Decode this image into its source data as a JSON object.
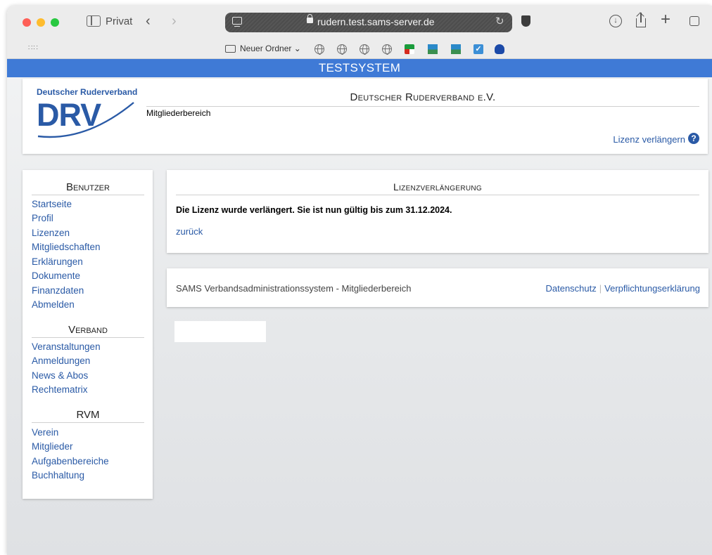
{
  "browser": {
    "private_label": "Privat",
    "url": "rudern.test.sams-server.de",
    "favorites": {
      "folder_label": "Neuer Ordner ⌄",
      "items": [
        "globe-icon",
        "globe-icon",
        "globe-icon",
        "globe-icon",
        "nrw-favicon",
        "sea-favicon",
        "sea-favicon",
        "check-favicon",
        "alien-favicon"
      ]
    }
  },
  "banner": {
    "text": "TESTSYSTEM"
  },
  "header": {
    "logo_text": "Deutscher Ruderverband",
    "logo_mark": "DRV",
    "org_title": "Deutscher Ruderverband e.V.",
    "subtitle": "Mitgliederbereich",
    "renew_link": "Lizenz verlängern"
  },
  "nav": {
    "sections": [
      {
        "title": "Benutzer",
        "items": [
          "Startseite",
          "Profil",
          "Lizenzen",
          "Mitgliedschaften",
          "Erklärungen",
          "Dokumente",
          "Finanzdaten",
          "Abmelden"
        ]
      },
      {
        "title": "Verband",
        "items": [
          "Veranstaltungen",
          "Anmeldungen",
          "News & Abos",
          "Rechtematrix"
        ]
      },
      {
        "title": "RVM",
        "items": [
          "Verein",
          "Mitglieder",
          "Aufgabenbereiche",
          "Buchhaltung"
        ]
      }
    ]
  },
  "main": {
    "title": "Lizenzverlängerung",
    "message": "Die Lizenz wurde verlängert. Sie ist nun gültig bis zum 31.12.2024.",
    "back_link": "zurück"
  },
  "footer": {
    "left_text": "SAMS Verbandsadministrationssystem - Mitgliederbereich",
    "link_privacy": "Datenschutz",
    "link_commitment": "Verpflichtungserklärung"
  },
  "colors": {
    "accent": "#3f7ad6",
    "link": "#2a5aa6"
  }
}
